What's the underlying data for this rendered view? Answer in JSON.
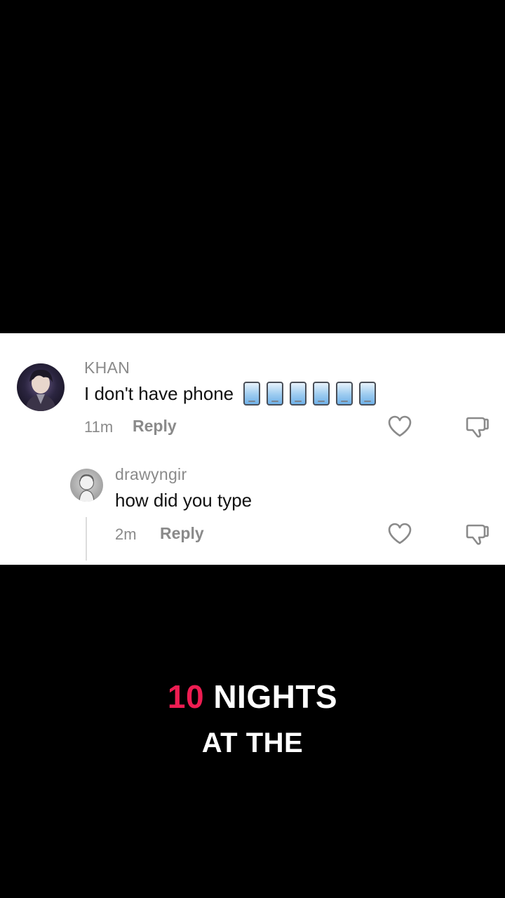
{
  "colors": {
    "background": "#000000",
    "card": "#ffffff",
    "muted_text": "#8a8a8a",
    "accent": "#ee1d52"
  },
  "comment": {
    "username": "KHAN",
    "text": "I don't have phone",
    "emoji_icons": [
      "mobile-phone-icon",
      "mobile-phone-icon",
      "mobile-phone-icon",
      "mobile-phone-icon",
      "mobile-phone-icon",
      "mobile-phone-icon"
    ],
    "time": "11m",
    "reply_label": "Reply"
  },
  "reply": {
    "username": "drawyngir",
    "text": "how did you type",
    "time": "2m",
    "reply_label": "Reply"
  },
  "overlay_title": {
    "number": "10",
    "line1_rest": "NIGHTS",
    "line2": "AT THE"
  }
}
